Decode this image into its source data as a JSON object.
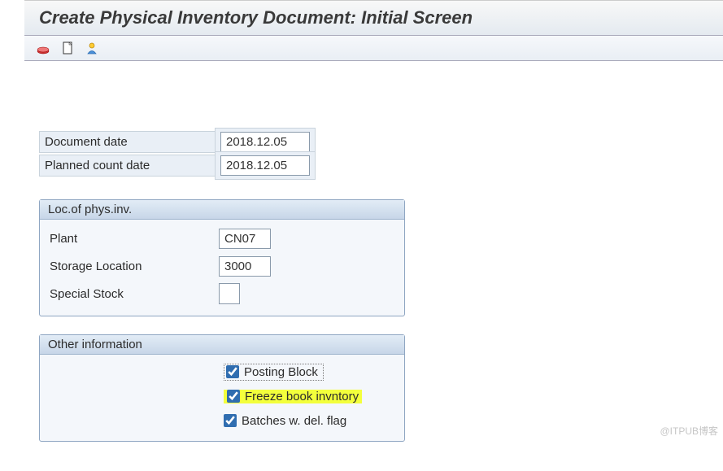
{
  "title": "Create Physical Inventory Document: Initial Screen",
  "toolbar": {
    "icon1": "print-icon",
    "icon2": "document-icon",
    "icon3": "user-icon"
  },
  "fields": {
    "document_date": {
      "label": "Document date",
      "value": "2018.12.05"
    },
    "planned_count_date": {
      "label": "Planned count date",
      "value": "2018.12.05"
    }
  },
  "loc_panel": {
    "header": "Loc.of phys.inv.",
    "plant": {
      "label": "Plant",
      "value": "CN07"
    },
    "storage_location": {
      "label": "Storage Location",
      "value": "3000"
    },
    "special_stock": {
      "label": "Special Stock",
      "value": ""
    }
  },
  "other_panel": {
    "header": "Other information",
    "posting_block": {
      "label": "Posting Block",
      "checked": true
    },
    "freeze_book": {
      "label": "Freeze book invntory",
      "checked": true
    },
    "batches_del": {
      "label": "Batches w. del. flag",
      "checked": true
    }
  },
  "watermark": "@ITPUB博客"
}
